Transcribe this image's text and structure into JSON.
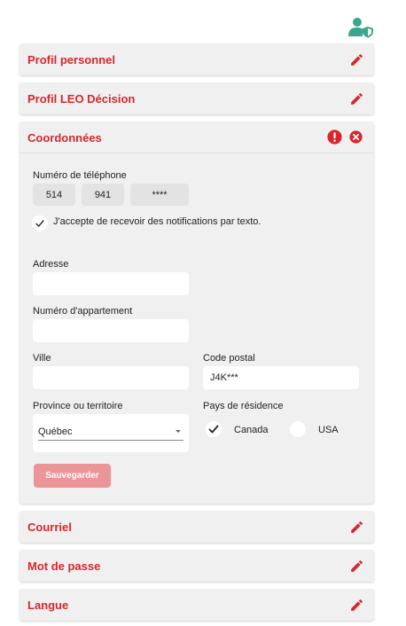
{
  "colors": {
    "accent": "#d9262e",
    "badge": "#3aa68e",
    "panel": "#f0f0f0",
    "save_disabled": "#ec9599"
  },
  "icons": {
    "user_badge": "user-shield-icon",
    "edit": "pencil-icon",
    "alert": "exclamation-circle-icon",
    "close": "close-circle-icon",
    "check": "checkmark-icon",
    "dropdown": "chevron-down-icon"
  },
  "sections": {
    "profil": {
      "title": "Profil personnel"
    },
    "leo": {
      "title": "Profil LEO Décision"
    },
    "coord": {
      "title": "Coordonnées"
    },
    "courriel": {
      "title": "Courriel"
    },
    "mdp": {
      "title": "Mot de passe"
    },
    "langue": {
      "title": "Langue"
    }
  },
  "coord": {
    "phone": {
      "label": "Numéro de téléphone",
      "area": "514",
      "prefix": "941",
      "line": "****"
    },
    "sms_optin": {
      "label": "J'accepte de recevoir des notifications par texto.",
      "checked": true
    },
    "adresse": {
      "label": "Adresse",
      "value": ""
    },
    "appartement": {
      "label": "Numéro d'appartement",
      "value": ""
    },
    "ville": {
      "label": "Ville",
      "value": ""
    },
    "code_postal": {
      "label": "Code postal",
      "value": "J4K***"
    },
    "province": {
      "label": "Province ou territoire",
      "value": "Québec"
    },
    "pays": {
      "label": "Pays de résidence",
      "options": [
        "Canada",
        "USA"
      ],
      "selected": "Canada"
    },
    "save_label": "Sauvegarder"
  }
}
